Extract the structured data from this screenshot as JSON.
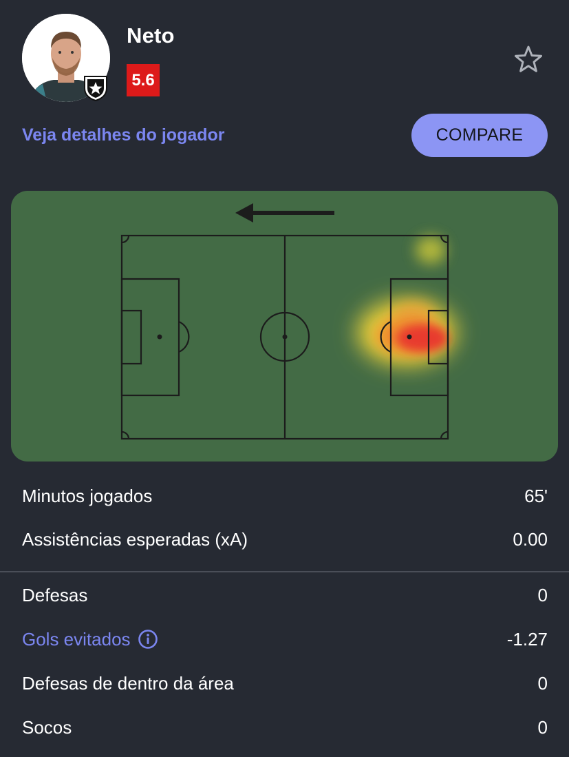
{
  "player": {
    "name": "Neto",
    "rating": "5.6",
    "rating_color": "#dd1a1a"
  },
  "actions": {
    "details_link": "Veja detalhes do jogador",
    "compare_label": "COMPARE"
  },
  "icons": {
    "favorite": "star-outline-icon",
    "attack_direction": "arrow-left-icon",
    "club": "botafogo-badge-icon",
    "info": "info-circle-icon"
  },
  "stats_top": [
    {
      "label": "Minutos jogados",
      "value": "65'"
    },
    {
      "label": "Assistências esperadas (xA)",
      "value": "0.00"
    }
  ],
  "stats_goalkeeper": [
    {
      "label": "Defesas",
      "value": "0"
    },
    {
      "label": "Gols evitados",
      "value": "-1.27"
    },
    {
      "label": "Defesas de dentro da área",
      "value": "0"
    },
    {
      "label": "Socos",
      "value": "0"
    }
  ],
  "colors": {
    "background": "#262a33",
    "accent": "#7b86f0",
    "button": "#8c95f4",
    "pitch": "#436b45"
  }
}
